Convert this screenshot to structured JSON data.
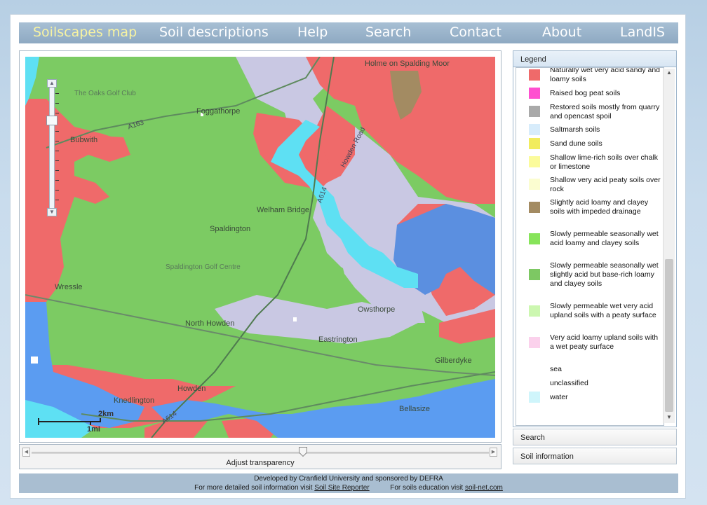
{
  "nav": {
    "items": [
      "Soilscapes map",
      "Soil descriptions",
      "Help",
      "Search",
      "Contact",
      "About",
      "LandIS"
    ]
  },
  "map": {
    "places": {
      "holme": "Holme on Spalding Moor",
      "oaks": "The Oaks Golf Club",
      "foggathorpe": "Foggathorpe",
      "bubwith": "Bubwith",
      "welham": "Welham Bridge",
      "spaldington": "Spaldington",
      "spaldington_golf": "Spaldington Golf Centre",
      "wressle": "Wressle",
      "north_howden": "North Howden",
      "owsthorpe": "Owsthorpe",
      "eastrington": "Eastrington",
      "gilberdyke": "Gilberdyke",
      "howden": "Howden",
      "knedlington": "Knedlington",
      "bellasize": "Bellasize"
    },
    "roads": {
      "a163": "A163",
      "a614": "A614",
      "howden_road": "Howden Road",
      "a614b": "A614"
    },
    "scale": {
      "km": "2km",
      "mi": "1mi"
    }
  },
  "transparency": {
    "label": "Adjust transparency",
    "value": 0.6
  },
  "legend": {
    "title": "Legend",
    "items": [
      {
        "label": "Naturally wet very acid sandy and loamy soils",
        "color": "#ef6a6a"
      },
      {
        "label": "Raised bog peat soils",
        "color": "#ff4fd0"
      },
      {
        "label": "Restored soils mostly from quarry and opencast spoil",
        "color": "#a9a9a9"
      },
      {
        "label": "Saltmarsh soils",
        "color": "#d7ecfb"
      },
      {
        "label": "Sand dune soils",
        "color": "#f1ec5e"
      },
      {
        "label": "Shallow lime-rich soils over chalk or limestone",
        "color": "#fbfb9b"
      },
      {
        "label": "Shallow very acid peaty soils over rock",
        "color": "#fbfdd0"
      },
      {
        "label": "Slightly acid loamy and clayey soils with impeded drainage",
        "color": "#a38b62"
      },
      {
        "label": "Slowly permeable seasonally wet acid loamy and clayey soils",
        "color": "#87e45a"
      },
      {
        "label": "Slowly permeable seasonally wet slightly acid but base-rich loamy and clayey soils",
        "color": "#7dc863"
      },
      {
        "label": "Slowly permeable wet very acid upland soils with a peaty surface",
        "color": "#ccf7b0"
      },
      {
        "label": "Very acid loamy upland soils with a wet peaty surface",
        "color": "#fbd1ec"
      },
      {
        "label": "sea",
        "color": "#ffffff"
      },
      {
        "label": "unclassified",
        "color": "#ffffff"
      },
      {
        "label": "water",
        "color": "#cff5fb"
      }
    ]
  },
  "panels": {
    "search": "Search",
    "soil_info": "Soil information"
  },
  "footer": {
    "line1": "Developed by Cranfield University and sponsored by DEFRA",
    "reporter_prefix": "For more detailed soil information visit ",
    "reporter_link": "Soil Site Reporter",
    "education_prefix": "For soils education visit ",
    "education_link": "soil-net.com"
  }
}
